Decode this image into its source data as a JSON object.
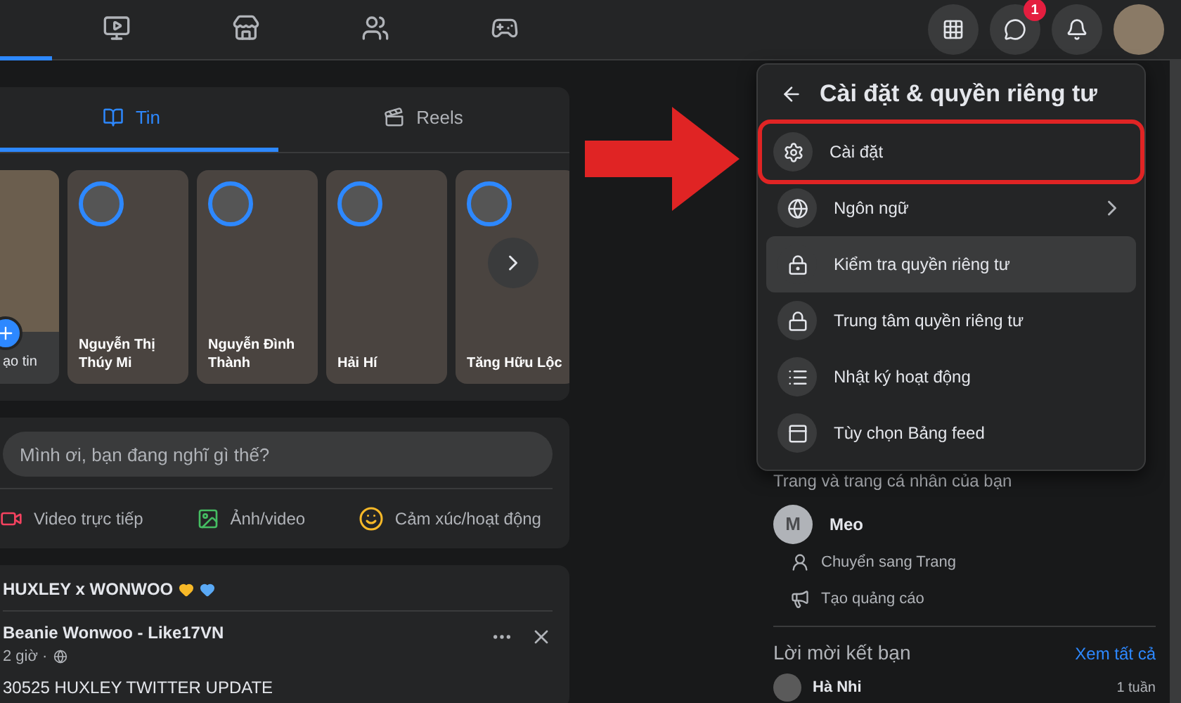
{
  "nav": {
    "tabs": [
      {
        "kind": "home",
        "selected": true
      },
      {
        "kind": "video",
        "selected": false
      },
      {
        "kind": "store",
        "selected": false
      },
      {
        "kind": "groups",
        "selected": false
      },
      {
        "kind": "gaming",
        "selected": false
      }
    ],
    "actions": [
      {
        "kind": "grid"
      },
      {
        "kind": "messenger",
        "badge": "1"
      },
      {
        "kind": "bell"
      },
      {
        "kind": "avatar"
      }
    ]
  },
  "feed_tabs": [
    {
      "kind": "book",
      "label": "Tin",
      "selected": true
    },
    {
      "kind": "reels",
      "label": "Reels",
      "selected": false
    }
  ],
  "stories": [
    {
      "kind": "create",
      "name": "ạo tin"
    },
    {
      "kind": "story",
      "name": "Nguyễn Thị Thúy Mi"
    },
    {
      "kind": "story",
      "name": "Nguyễn Đình Thành"
    },
    {
      "kind": "story",
      "name": "Hải Hí"
    },
    {
      "kind": "story",
      "name": "Tăng Hữu Lộc"
    }
  ],
  "composer": {
    "placeholder": "Mình ơi, bạn đang nghĩ gì thế?",
    "actions": [
      {
        "kind": "live",
        "label": "Video trực tiếp"
      },
      {
        "kind": "photo",
        "label": "Ảnh/video"
      },
      {
        "kind": "feeling",
        "label": "Cảm xúc/hoạt động"
      }
    ]
  },
  "post": {
    "group": "HUXLEY x WONWOO",
    "author": "Beanie Wonwoo - Like17VN",
    "time": "2 giờ ·",
    "text": "30525 HUXLEY TWITTER UPDATE"
  },
  "menu": {
    "title": "Cài đặt & quyền riêng tư",
    "items": [
      {
        "kind": "gear",
        "label": "Cài đặt",
        "has_submenu": false,
        "hovered": false,
        "annotated": true
      },
      {
        "kind": "globe",
        "label": "Ngôn ngữ",
        "has_submenu": true,
        "hovered": false,
        "annotated": false
      },
      {
        "kind": "lock-check",
        "label": "Kiểm tra quyền riêng tư",
        "has_submenu": false,
        "hovered": true,
        "annotated": false
      },
      {
        "kind": "lock",
        "label": "Trung tâm quyền riêng tư",
        "has_submenu": false,
        "hovered": false,
        "annotated": false
      },
      {
        "kind": "list",
        "label": "Nhật ký hoạt động",
        "has_submenu": false,
        "hovered": false,
        "annotated": false
      },
      {
        "kind": "feed",
        "label": "Tùy chọn Bảng feed",
        "has_submenu": false,
        "hovered": false,
        "annotated": false
      }
    ]
  },
  "right": {
    "section_title": "Trang và trang cá nhân của bạn",
    "page": {
      "initial": "M",
      "name": "Meo"
    },
    "page_actions": [
      {
        "kind": "switch",
        "label": "Chuyển sang Trang"
      },
      {
        "kind": "megaphone",
        "label": "Tạo quảng cáo"
      }
    ],
    "requests": {
      "title": "Lời mời kết bạn",
      "link": "Xem tất cả",
      "first": {
        "name": "Hà Nhi",
        "time": "1 tuần"
      }
    }
  }
}
